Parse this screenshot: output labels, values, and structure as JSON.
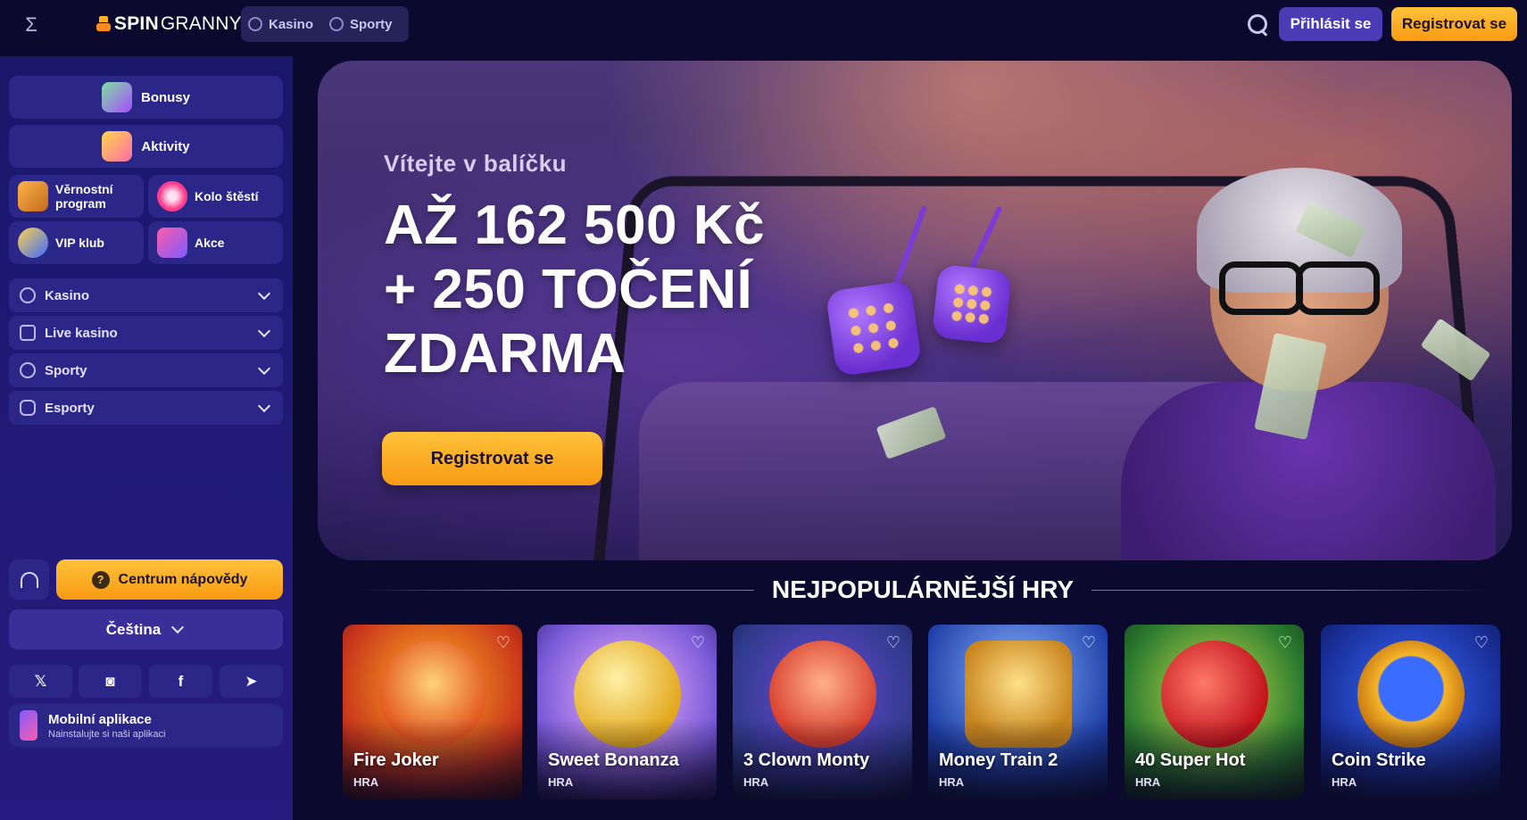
{
  "header": {
    "logo": {
      "spin": "SPIN",
      "granny": "GRANNY"
    },
    "tabs": [
      {
        "label": "Kasino",
        "icon": "casino-chip-icon"
      },
      {
        "label": "Sporty",
        "icon": "soccer-ball-icon"
      }
    ],
    "login_label": "Přihlásit se",
    "register_label": "Registrovat se"
  },
  "sidebar": {
    "wide_items": [
      {
        "label": "Bonusy",
        "icon": "bonus-mask-icon"
      },
      {
        "label": "Aktivity",
        "icon": "clipboard-icon"
      }
    ],
    "grid_items": [
      {
        "label": "Věrnostní program",
        "icon": "loyalty-chest-icon"
      },
      {
        "label": "Kolo štěstí",
        "icon": "wheel-of-fortune-icon"
      },
      {
        "label": "VIP klub",
        "icon": "vip-ring-icon"
      },
      {
        "label": "Akce",
        "icon": "promo-phone-icon"
      }
    ],
    "accordions": [
      {
        "label": "Kasino",
        "icon": "casino-chip-icon"
      },
      {
        "label": "Live kasino",
        "icon": "camera-icon"
      },
      {
        "label": "Sporty",
        "icon": "soccer-ball-icon"
      },
      {
        "label": "Esporty",
        "icon": "gamepad-icon"
      }
    ],
    "help_label": "Centrum nápovědy",
    "help_icon_text": "?",
    "language_label": "Čeština",
    "socials": [
      {
        "name": "x-icon",
        "glyph": "𝕏"
      },
      {
        "name": "instagram-icon",
        "glyph": "◙"
      },
      {
        "name": "facebook-icon",
        "glyph": "f"
      },
      {
        "name": "telegram-icon",
        "glyph": "➤"
      }
    ],
    "app": {
      "title": "Mobilní aplikace",
      "subtitle": "Nainstalujte si naši aplikaci"
    }
  },
  "hero": {
    "kicker": "Vítejte v balíčku",
    "headline_lines": [
      "AŽ 162 500 Kč",
      "+ 250 TOČENÍ",
      "ZDARMA"
    ],
    "cta_label": "Registrovat se"
  },
  "popular": {
    "title": "NEJPOPULÁRNĚJŠÍ HRY",
    "games": [
      {
        "name": "Fire Joker",
        "type": "HRA",
        "colors": [
          "#c8341c",
          "#ffb020"
        ]
      },
      {
        "name": "Sweet Bonanza",
        "type": "HRA",
        "colors": [
          "#7a5ad8",
          "#f2c14a"
        ]
      },
      {
        "name": "3 Clown Monty",
        "type": "HRA",
        "colors": [
          "#2f3a8a",
          "#d8402e"
        ]
      },
      {
        "name": "Money Train 2",
        "type": "HRA",
        "colors": [
          "#1e3fa8",
          "#f0b43a"
        ]
      },
      {
        "name": "40 Super Hot",
        "type": "HRA",
        "colors": [
          "#2b7a30",
          "#e2242a"
        ]
      },
      {
        "name": "Coin Strike",
        "type": "HRA",
        "colors": [
          "#1a2f9a",
          "#f5b52a"
        ]
      }
    ]
  },
  "colors": {
    "background": "#0b0a2e",
    "sidebar": "#1d1870",
    "accent_orange": "#f9a91c",
    "accent_purple": "#4b3bb4"
  }
}
